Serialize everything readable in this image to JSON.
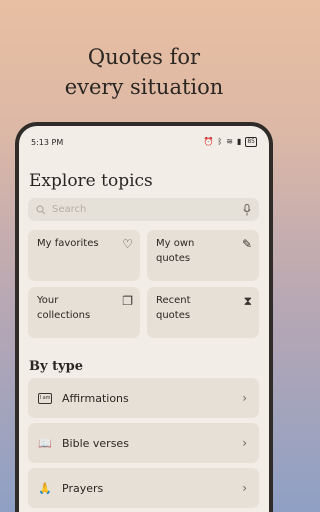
{
  "headline": {
    "line1": "Quotes for",
    "line2": "every situation"
  },
  "status_bar": {
    "time": "5:13 PM",
    "icons": [
      "alarm-icon",
      "bluetooth-icon",
      "wifi-icon",
      "signal-icon",
      "battery-icon"
    ],
    "battery": "85"
  },
  "screen": {
    "title": "Explore topics",
    "search": {
      "placeholder": "Search"
    },
    "tiles": [
      {
        "line1": "My favorites",
        "line2": "",
        "icon": "heart-icon"
      },
      {
        "line1": "My own",
        "line2": "quotes",
        "icon": "pen-icon"
      },
      {
        "line1": "Your",
        "line2": "collections",
        "icon": "collections-icon"
      },
      {
        "line1": "Recent",
        "line2": "quotes",
        "icon": "hourglass-icon"
      }
    ],
    "section_title": "By type",
    "types": [
      {
        "label": "Affirmations",
        "icon": "i-am-icon",
        "icon_text": "I am"
      },
      {
        "label": "Bible verses",
        "icon": "book-icon"
      },
      {
        "label": "Prayers",
        "icon": "praying-hands-icon"
      }
    ]
  },
  "colors": {
    "screen_bg": "#F2EEE7",
    "card_bg": "#E6E0D6",
    "text": "#2A2622",
    "frame": "#2E2B29"
  }
}
